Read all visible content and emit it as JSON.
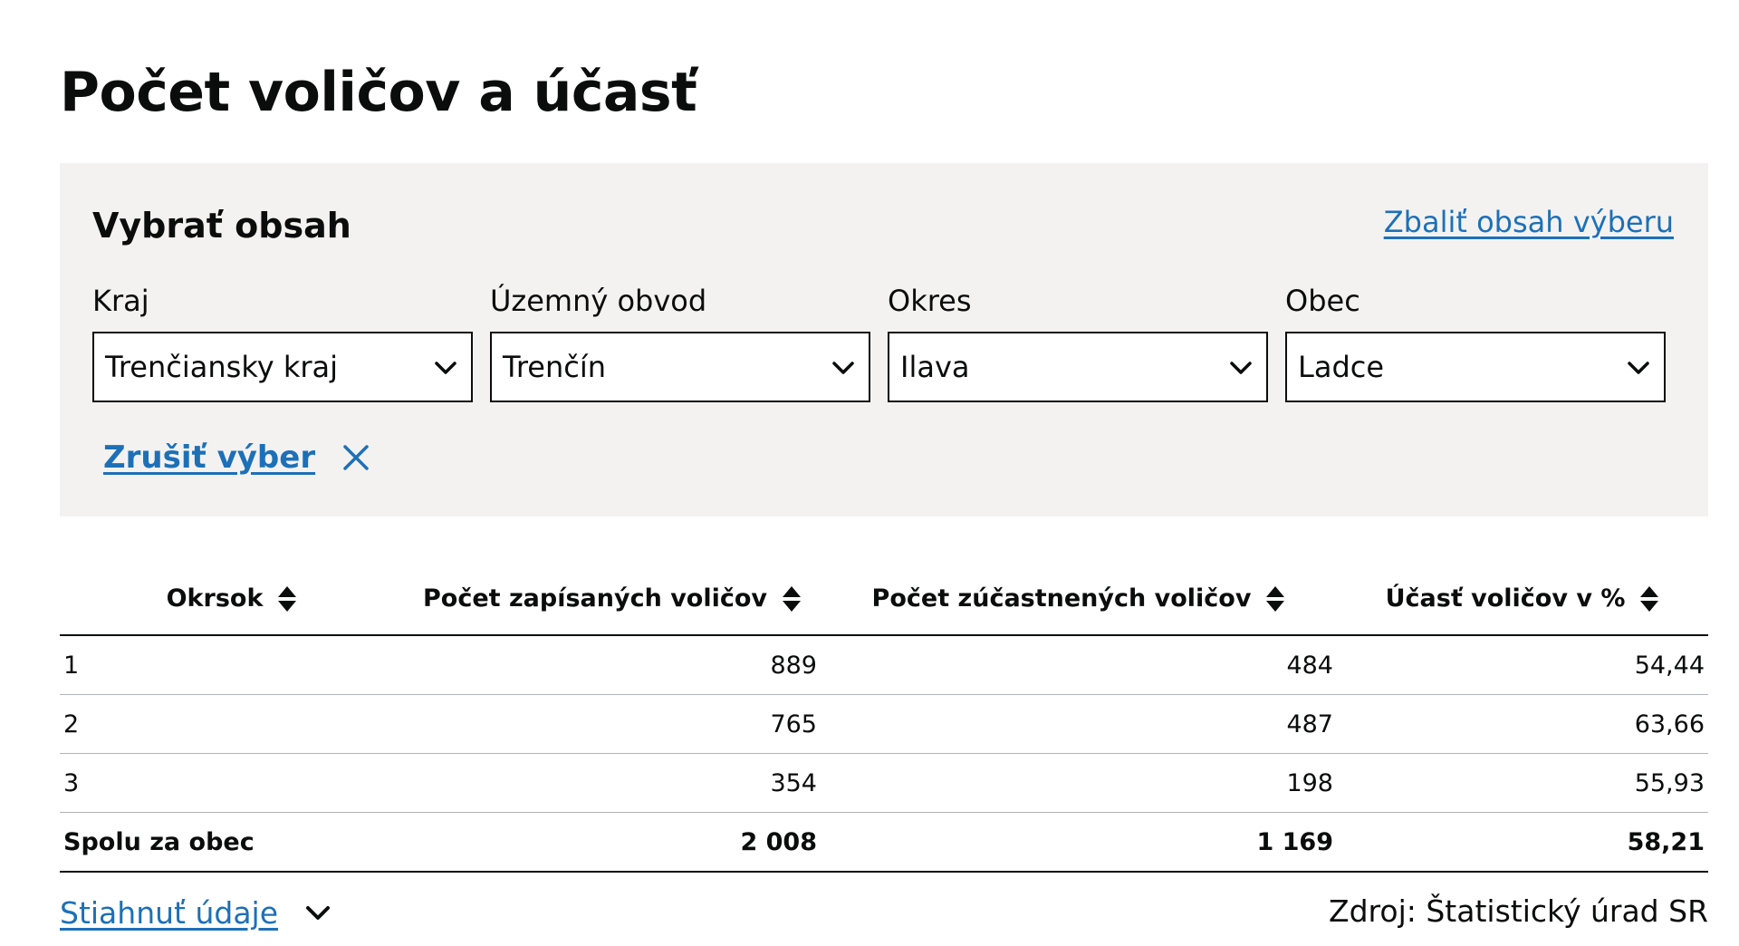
{
  "page": {
    "title": "Počet voličov a účasť"
  },
  "filter": {
    "heading": "Vybrať obsah",
    "collapse_label": "Zbaliť obsah výberu",
    "fields": [
      {
        "label": "Kraj",
        "value": "Trenčiansky kraj"
      },
      {
        "label": "Územný obvod",
        "value": "Trenčín"
      },
      {
        "label": "Okres",
        "value": "Ilava"
      },
      {
        "label": "Obec",
        "value": "Ladce"
      }
    ],
    "clear_label": "Zrušiť výber"
  },
  "table": {
    "headers": [
      "Okrsok",
      "Počet zapísaných voličov",
      "Počet zúčastnených voličov",
      "Účasť voličov v %"
    ],
    "rows": [
      [
        "1",
        "889",
        "484",
        "54,44"
      ],
      [
        "2",
        "765",
        "487",
        "63,66"
      ],
      [
        "3",
        "354",
        "198",
        "55,93"
      ]
    ],
    "total": [
      "Spolu za obec",
      "2 008",
      "1 169",
      "58,21"
    ]
  },
  "footer": {
    "download_label": "Stiahnuť údaje",
    "source": "Zdroj: Štatistický úrad SR"
  },
  "colors": {
    "link": "#1d70b8",
    "panel_background": "#f3f2f1",
    "text": "#0b0c0c",
    "row_border": "#b1b4b6"
  },
  "icons": {
    "select": "chevron-down-icon",
    "clear": "close-icon",
    "sort": "sort-icon",
    "download": "chevron-down-icon"
  }
}
